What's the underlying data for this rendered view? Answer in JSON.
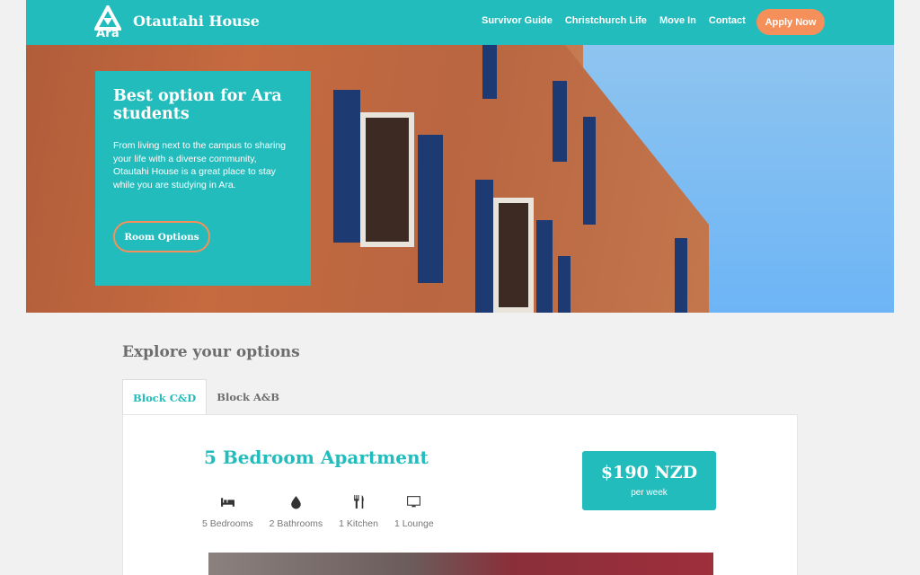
{
  "header": {
    "logo_text": "Ara",
    "site_title": "Otautahi House",
    "nav": [
      "Survivor Guide",
      "Christchurch Life",
      "Move In",
      "Contact"
    ],
    "cta": "Apply Now"
  },
  "hero": {
    "heading": "Best option for Ara students",
    "body": "From living next to the campus to sharing your life with a diverse community, Otautahi House is a great place to stay while you are studying in Ara.",
    "button": "Room Options"
  },
  "explore": {
    "title": "Explore your options",
    "tabs": [
      "Block C&D",
      "Block A&B"
    ],
    "active_tab": "Block C&D"
  },
  "apartment": {
    "title": "5 Bedroom Apartment",
    "amenities": [
      {
        "icon": "bed-icon",
        "label": "5 Bedrooms"
      },
      {
        "icon": "water-drop-icon",
        "label": "2 Bathrooms"
      },
      {
        "icon": "cutlery-icon",
        "label": "1 Kitchen"
      },
      {
        "icon": "tv-icon",
        "label": "1 Lounge"
      }
    ],
    "price": "$190 NZD",
    "price_period": "per week"
  },
  "colors": {
    "brand_teal": "#22bcbc",
    "accent_orange": "#f5905a"
  }
}
